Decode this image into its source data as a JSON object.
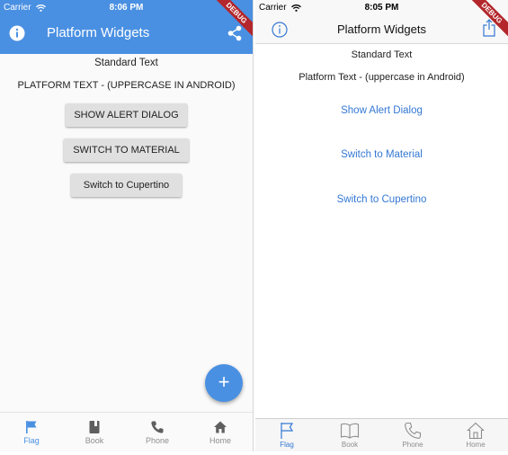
{
  "material": {
    "status": {
      "carrier": "Carrier",
      "time": "8:06 PM"
    },
    "title": "Platform Widgets",
    "debug_banner": "DEBUG",
    "standard_text": "Standard Text",
    "platform_text": "PLATFORM TEXT - (UPPERCASE IN ANDROID)",
    "buttons": {
      "alert": "SHOW ALERT DIALOG",
      "switch_material": "SWITCH TO MATERIAL",
      "switch_cupertino": "Switch to Cupertino"
    },
    "fab_label": "+",
    "nav": [
      {
        "label": "Flag",
        "icon": "flag-icon",
        "active": true
      },
      {
        "label": "Book",
        "icon": "book-icon",
        "active": false
      },
      {
        "label": "Phone",
        "icon": "phone-icon",
        "active": false
      },
      {
        "label": "Home",
        "icon": "home-icon",
        "active": false
      }
    ]
  },
  "cupertino": {
    "status": {
      "carrier": "Carrier",
      "time": "8:05 PM"
    },
    "title": "Platform Widgets",
    "debug_banner": "DEBUG",
    "standard_text": "Standard Text",
    "platform_text": "Platform Text - (uppercase in Android)",
    "buttons": {
      "alert": "Show Alert Dialog",
      "switch_material": "Switch to Material",
      "switch_cupertino": "Switch to Cupertino"
    },
    "nav": [
      {
        "label": "Flag",
        "icon": "flag-outline-icon",
        "active": true
      },
      {
        "label": "Book",
        "icon": "book-outline-icon",
        "active": false
      },
      {
        "label": "Phone",
        "icon": "phone-outline-icon",
        "active": false
      },
      {
        "label": "Home",
        "icon": "home-outline-icon",
        "active": false
      }
    ]
  },
  "colors": {
    "material_primary": "#4a90e2",
    "cupertino_accent": "#3478d4",
    "debug_banner": "#b3262b"
  }
}
